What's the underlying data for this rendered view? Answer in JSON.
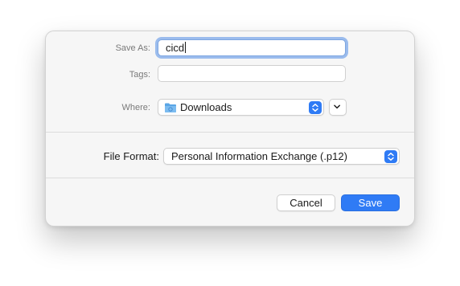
{
  "dialog": {
    "save_as": {
      "label": "Save As:",
      "value": "cicd"
    },
    "tags": {
      "label": "Tags:",
      "value": ""
    },
    "where": {
      "label": "Where:",
      "selected": "Downloads",
      "icon": "folder-icon"
    },
    "file_format": {
      "label": "File Format:",
      "selected": "Personal Information Exchange (.p12)"
    },
    "buttons": {
      "cancel_label": "Cancel",
      "save_label": "Save"
    },
    "colors": {
      "accent": "#2f7bf5",
      "focus_ring": "#5f96ea",
      "folder_blue": "#5aa6e6"
    }
  }
}
